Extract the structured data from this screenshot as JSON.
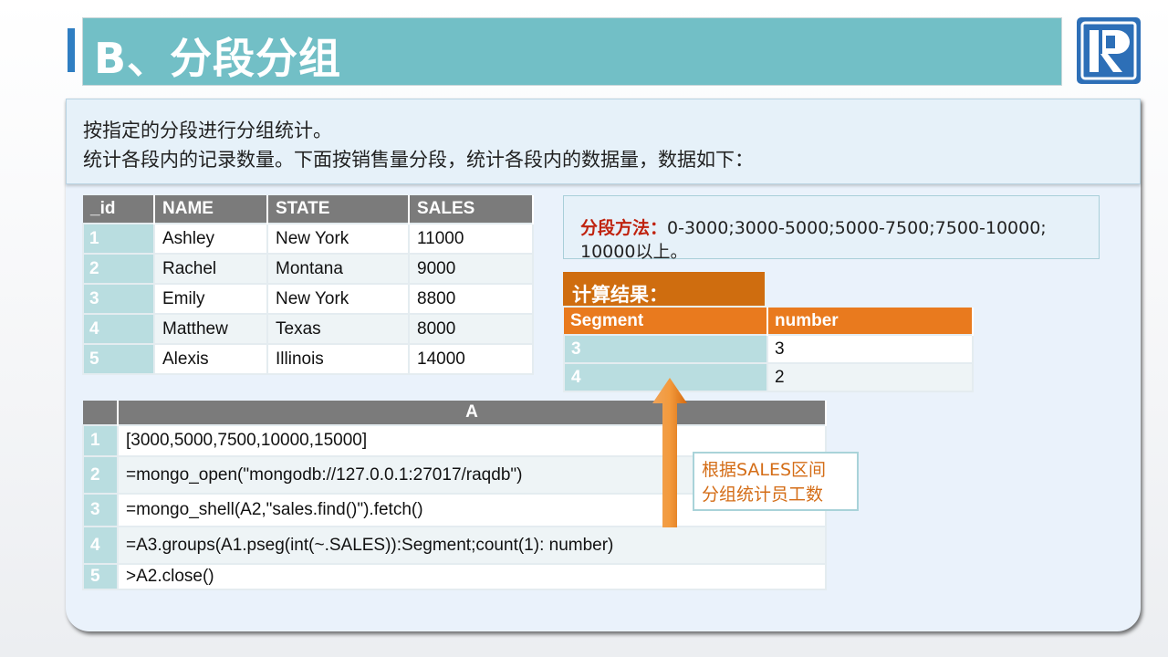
{
  "title": "B、分段分组",
  "intro": {
    "line1": "按指定的分段进行分组统计。",
    "line2": "统计各段内的记录数量。下面按销售量分段，统计各段内的数据量，数据如下："
  },
  "data_table": {
    "headers": [
      "_id",
      "NAME",
      "STATE",
      "SALES"
    ],
    "rows": [
      [
        "1",
        "Ashley",
        "New York",
        "11000"
      ],
      [
        "2",
        "Rachel",
        "Montana",
        "9000"
      ],
      [
        "3",
        "Emily",
        "New York",
        "8800"
      ],
      [
        "4",
        "Matthew",
        "Texas",
        "8000"
      ],
      [
        "5",
        "Alexis",
        "Illinois",
        "14000"
      ]
    ]
  },
  "segment_note": {
    "label": "分段方法：",
    "text1": "0-3000;3000-5000;5000-7500;7500-10000;",
    "text2": "10000以上。"
  },
  "result": {
    "title": "计算结果：",
    "headers": [
      "Segment",
      "number"
    ],
    "rows": [
      [
        "3",
        "3"
      ],
      [
        "4",
        "2"
      ]
    ]
  },
  "code_grid": {
    "col_header": "A",
    "rows": [
      [
        "1",
        "[3000,5000,7500,10000,15000]"
      ],
      [
        "2",
        "=mongo_open(\"mongodb://127.0.0.1:27017/raqdb\")"
      ],
      [
        "3",
        "=mongo_shell(A2,\"sales.find()\").fetch()"
      ],
      [
        "4",
        "=A3.groups(A1.pseg(int(~.SALES)):Segment;count(1):  number)"
      ],
      [
        "5",
        ">A2.close()"
      ]
    ]
  },
  "callout": {
    "line1": "根据SALES区间",
    "line2": "分组统计员工数"
  },
  "colors": {
    "title_bar": "#72bfc6",
    "accent_blue": "#2f7ec2",
    "header_gray": "#7b7b7b",
    "row_number_teal": "#b9dde0",
    "result_orange": "#e97a1e",
    "label_red": "#c0230f"
  },
  "icons": {
    "logo": "raqsoft-r-logo-icon",
    "arrow": "up-arrow-icon"
  }
}
